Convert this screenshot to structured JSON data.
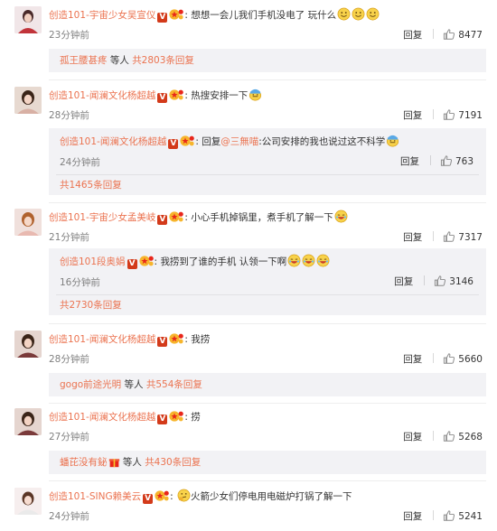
{
  "comments": [
    {
      "user": "创造101-宇宙少女吴宣仪",
      "text": "想想一会儿我们手机没电了 玩什么",
      "time": "23分钟前",
      "reply_label": "回复",
      "likes": "8477",
      "sub": {
        "more_user": "孤王腰甚疼",
        "more_mid": " 等人 ",
        "more_count": "共2803条回复"
      }
    },
    {
      "user": "创造101-闻澜文化杨超越",
      "text": "热搜安排一下",
      "time": "28分钟前",
      "reply_label": "回复",
      "likes": "7191",
      "sub_reply": {
        "user": "创造101-闻澜文化杨超越",
        "prefix": "回复",
        "mention": "@三無喵",
        "text": ":公司安排的我也说过这不科学",
        "time": "24分钟前",
        "reply_label": "回复",
        "likes": "763"
      },
      "sub": {
        "more_count": "共1465条回复"
      }
    },
    {
      "user": "创造101-宇宙少女孟美岐",
      "text": "小心手机掉锅里，煮手机了解一下",
      "time": "21分钟前",
      "reply_label": "回复",
      "likes": "7317",
      "sub_reply": {
        "user": "创造101段奥娟",
        "text": "我捞到了谁的手机 认领一下啊",
        "time": "16分钟前",
        "reply_label": "回复",
        "likes": "3146"
      },
      "sub": {
        "more_count": "共2730条回复"
      }
    },
    {
      "user": "创造101-闻澜文化杨超越",
      "text": "我捞",
      "time": "28分钟前",
      "reply_label": "回复",
      "likes": "5660",
      "sub": {
        "more_user": "gogo前途光明",
        "more_mid": " 等人 ",
        "more_count": "共554条回复"
      }
    },
    {
      "user": "创造101-闻澜文化杨超越",
      "text": "捞",
      "time": "27分钟前",
      "reply_label": "回复",
      "likes": "5268",
      "sub": {
        "more_user": "蟠芘没有鉍",
        "more_mid": " 等人 ",
        "more_count": "共430条回复"
      }
    },
    {
      "user": "创造101-SING赖美云",
      "text": "火箭少女们停电用电磁炉打锅了解一下",
      "time": "24分钟前",
      "reply_label": "回复",
      "likes": "5241"
    }
  ],
  "badge_v": "V",
  "colon": ":",
  "icons": {
    "like": "thumbs-up-icon",
    "verified": "v-badge-icon",
    "star": "star-badge-icon",
    "emoji": "smiley-icon"
  },
  "colors": {
    "accent": "#eb7350",
    "muted": "#808080",
    "subbg": "#f2f2f5"
  }
}
